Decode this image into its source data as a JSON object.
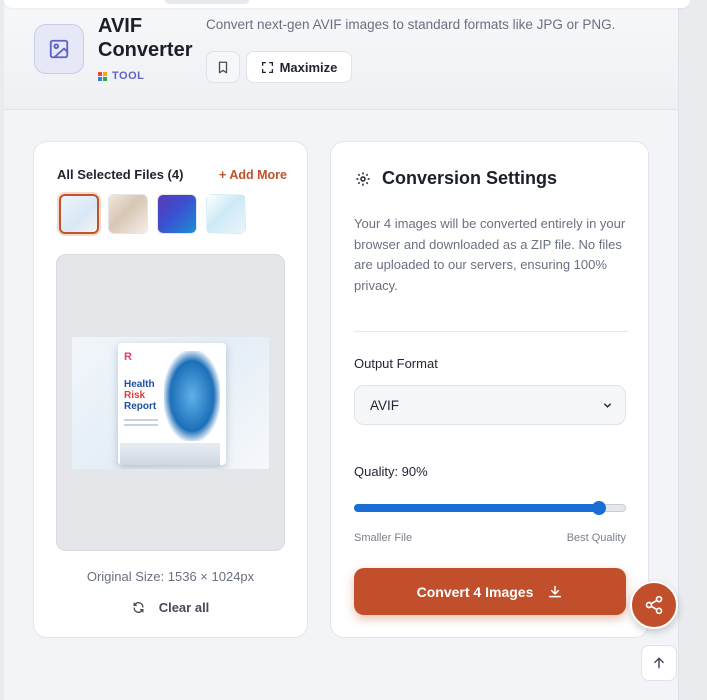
{
  "header": {
    "title": "AVIF Converter",
    "badge": "TOOL",
    "description": "Convert next-gen AVIF images to standard formats like JPG or PNG.",
    "maximize_label": "Maximize",
    "icons": {
      "tool": "image-icon",
      "bookmark": "bookmark-icon",
      "maximize": "expand-icon"
    }
  },
  "files": {
    "title": "All Selected Files (4)",
    "add_more": "+ Add More",
    "thumbnails": [
      "thumbnail-1",
      "thumbnail-2",
      "thumbnail-3",
      "thumbnail-4"
    ],
    "selected_index": 0,
    "preview_text": {
      "logo": "R",
      "line1": "Health",
      "line2": "Risk",
      "line3": "Report"
    },
    "original_size": "Original Size: 1536 × 1024px",
    "clear_all": "Clear all"
  },
  "settings": {
    "title": "Conversion Settings",
    "description": "Your 4 images will be converted entirely in your browser and downloaded as a ZIP file. No files are uploaded to our servers, ensuring 100% privacy.",
    "output_format_label": "Output Format",
    "output_format_value": "AVIF",
    "quality_label": "Quality: 90%",
    "quality_value": 0.9,
    "slider_min_label": "Smaller File",
    "slider_max_label": "Best Quality",
    "convert_label": "Convert 4 Images"
  },
  "fabs": {
    "share": "share-icon",
    "scroll_top": "arrow-up-icon"
  },
  "colors": {
    "accent": "#c24f2b",
    "slider": "#1a6fd6",
    "badge": "#5f63c9"
  }
}
